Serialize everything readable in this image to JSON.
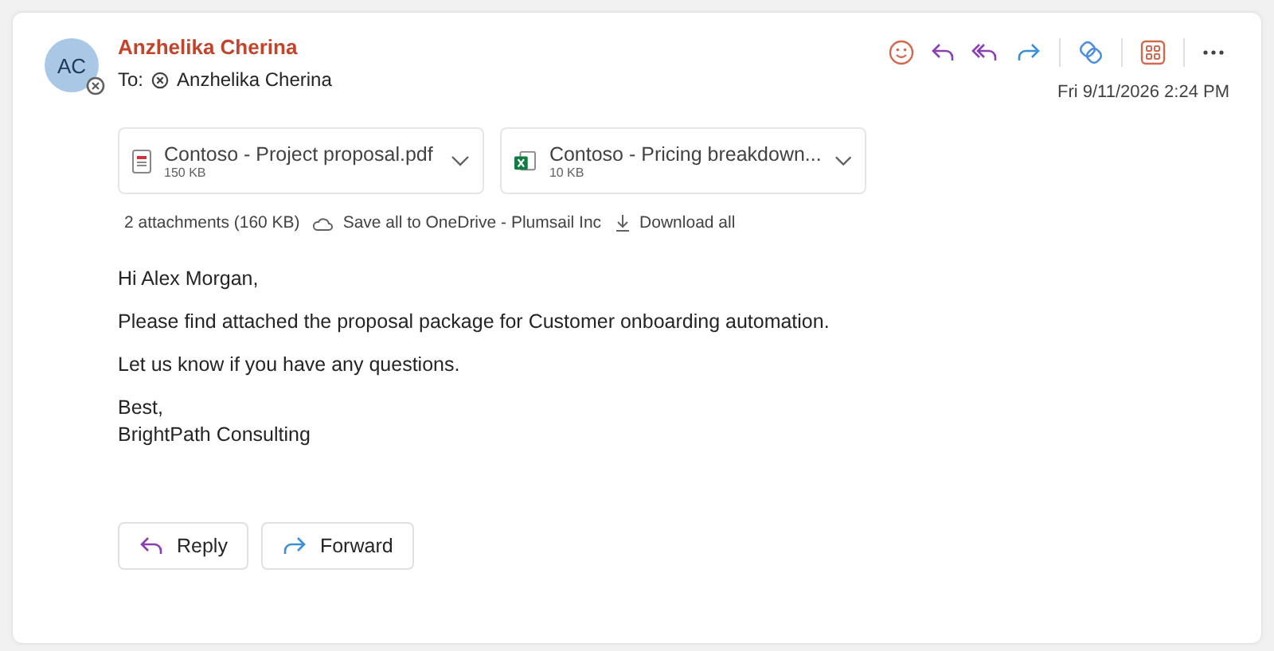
{
  "sender": {
    "initials": "AC",
    "name": "Anzhelika Cherina"
  },
  "recipients": {
    "label": "To:",
    "names": [
      "Anzhelika Cherina"
    ]
  },
  "date": "Fri 9/11/2026 2:24 PM",
  "attachments": [
    {
      "kind": "pdf",
      "name": "Contoso - Project proposal.pdf",
      "size": "150 KB"
    },
    {
      "kind": "excel",
      "name": "Contoso - Pricing breakdown...",
      "size": "10 KB"
    }
  ],
  "attachment_bar": {
    "summary": "2 attachments (160 KB)",
    "save": "Save all to OneDrive - Plumsail Inc",
    "download": "Download all"
  },
  "body": [
    "Hi Alex Morgan,",
    "Please find attached the proposal package for Customer onboarding automation.",
    "Let us know if you have any questions."
  ],
  "signature": [
    "Best,",
    "BrightPath Consulting"
  ],
  "actions": [
    {
      "kind": "reply",
      "label": "Reply"
    },
    {
      "kind": "forward",
      "label": "Forward"
    }
  ]
}
